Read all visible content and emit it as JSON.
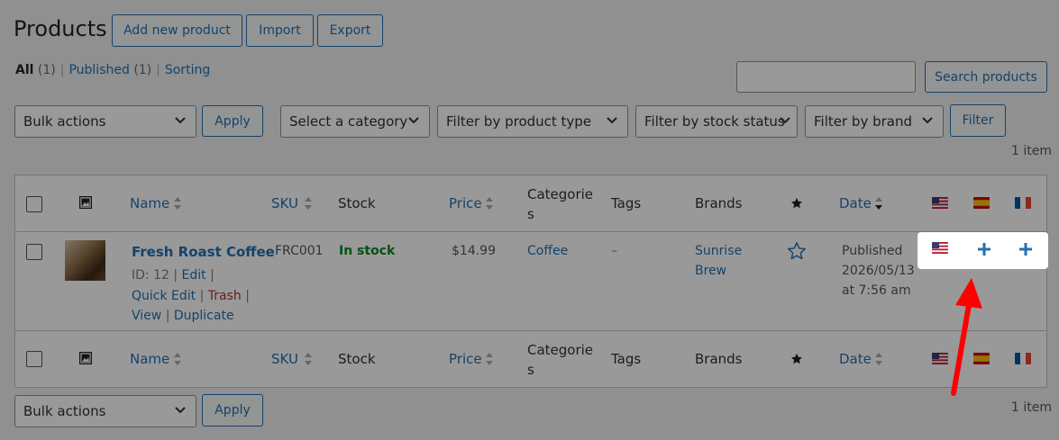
{
  "page": {
    "title": "Products",
    "add_new_label": "Add new product",
    "import_label": "Import",
    "export_label": "Export"
  },
  "views": {
    "all_label": "All",
    "all_count": "(1)",
    "published_label": "Published",
    "published_count": "(1)",
    "sorting_label": "Sorting",
    "separator": "|"
  },
  "search": {
    "value": "",
    "button_label": "Search products"
  },
  "filters": {
    "bulk_actions": "Bulk actions",
    "apply_label": "Apply",
    "category": "Select a category",
    "product_type": "Filter by product type",
    "stock_status": "Filter by stock status",
    "brand": "Filter by brand",
    "filter_label": "Filter"
  },
  "items_count": "1 item",
  "table": {
    "headers": {
      "name": "Name",
      "sku": "SKU",
      "stock": "Stock",
      "price": "Price",
      "categories_line1": "Categorie",
      "categories_line2": "s",
      "tags": "Tags",
      "brands": "Brands",
      "date": "Date"
    },
    "rows": [
      {
        "name": "Fresh Roast Coffee",
        "id_text": "ID: 12",
        "edit": "Edit",
        "quick_edit": "Quick Edit",
        "trash": "Trash",
        "view": "View",
        "duplicate": "Duplicate",
        "sku": "FRC001",
        "stock": "In stock",
        "price": "$14.99",
        "category": "Coffee",
        "tags": "–",
        "brand_line1": "Sunrise",
        "brand_line2": "Brew",
        "date_status": "Published",
        "date_value": "2026/05/13",
        "date_time": "at 7:56 am",
        "separator": "|"
      }
    ]
  },
  "languages": [
    "en-us-flag-icon",
    "es-flag-icon",
    "fr-flag-icon"
  ],
  "colors": {
    "link": "#2271b1",
    "in_stock": "#008a20",
    "trash": "#b32d2e",
    "arrow": "#ff0000"
  }
}
